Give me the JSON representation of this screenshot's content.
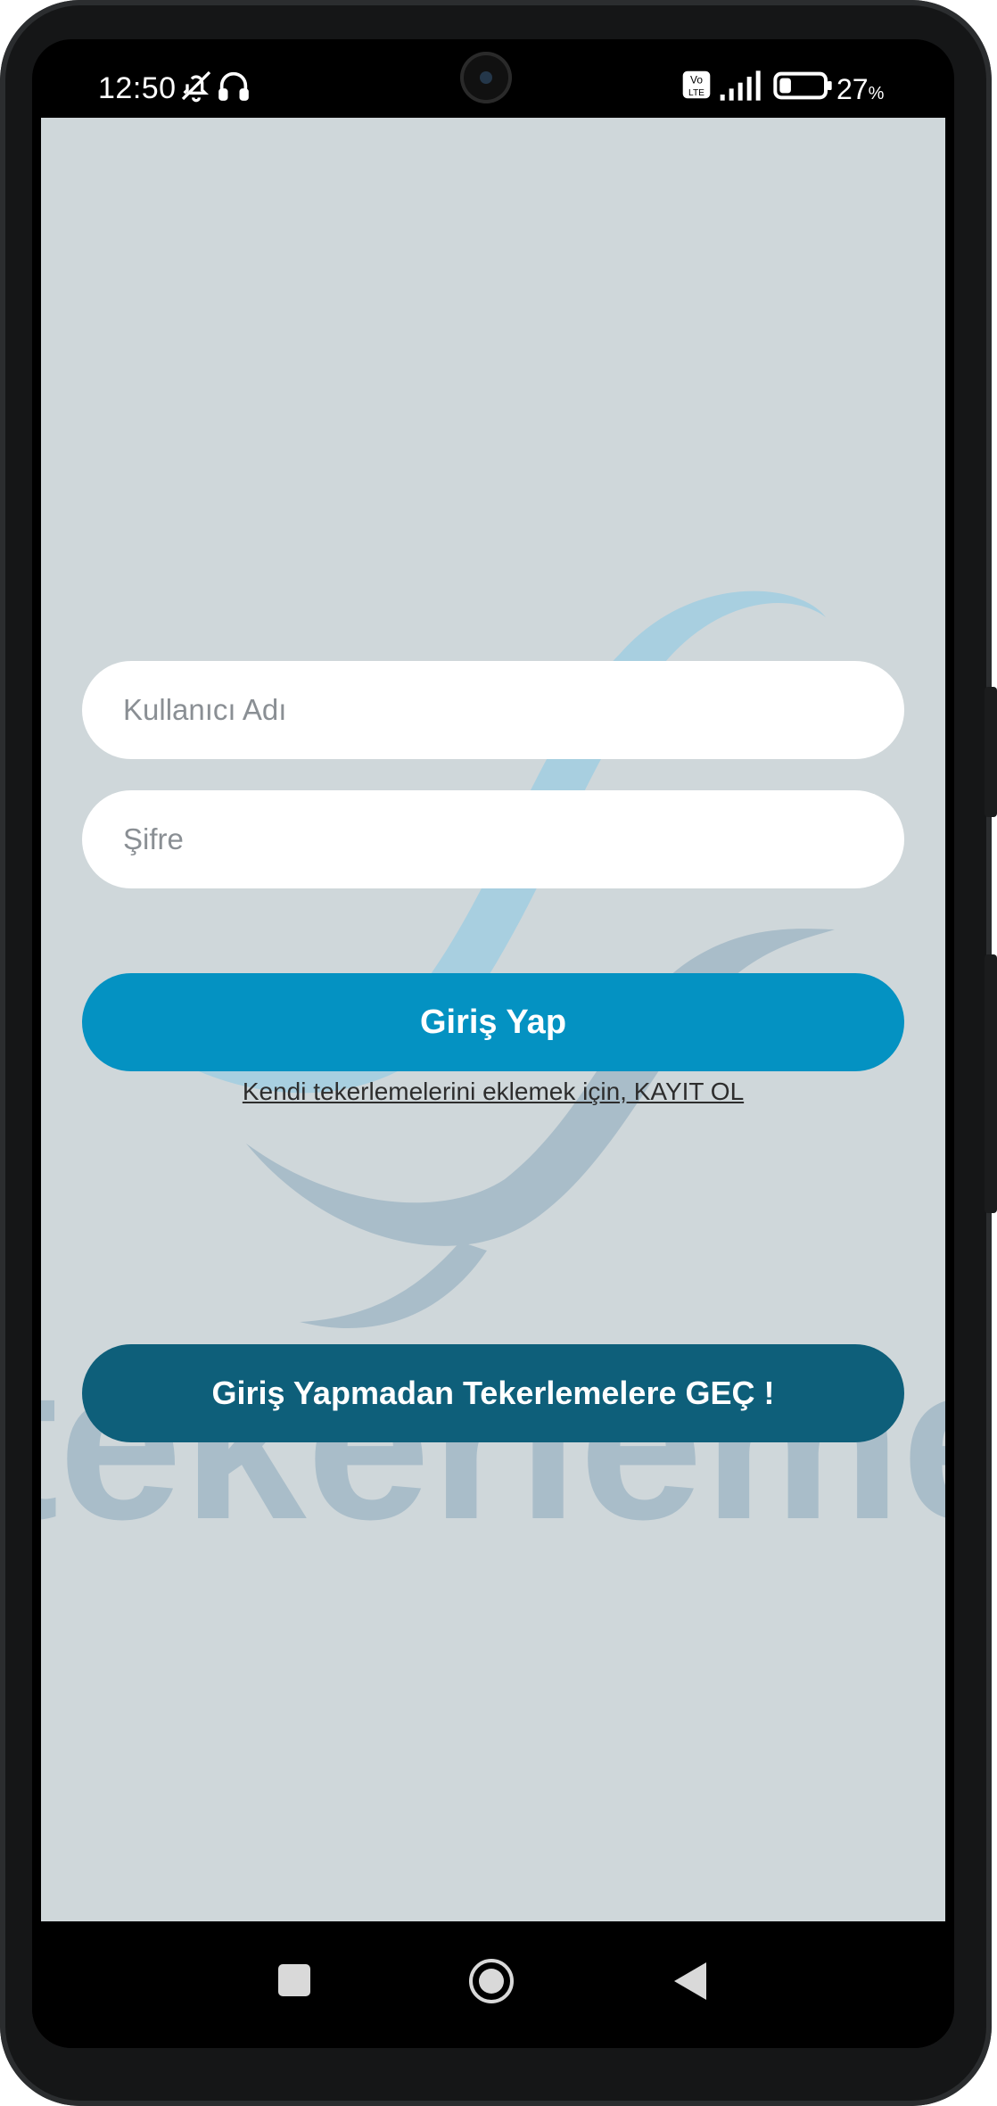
{
  "status_bar": {
    "time": "12:50",
    "battery_percent": "27",
    "battery_unit": "%",
    "battery_level": 0.27,
    "icons": [
      "bell-off-icon",
      "headphones-icon",
      "volte-icon",
      "signal-icon",
      "battery-icon"
    ]
  },
  "login": {
    "username_placeholder": "Kullanıcı Adı",
    "username_value": "",
    "password_placeholder": "Şifre",
    "password_value": "",
    "login_button": "Giriş Yap",
    "register_link": "Kendi tekerlemelerini eklemek için, KAYIT OL",
    "skip_button": "Giriş Yapmadan Tekerlemelere GEÇ !"
  },
  "background_logo": {
    "text": "tekerleme",
    "colors": {
      "light_swoosh": "#a8cfe0",
      "dark_swoosh": "#a9bdc9",
      "text": "#a9bdc9"
    }
  },
  "nav_bar": {
    "icons": [
      "recent-apps-icon",
      "home-icon",
      "back-icon"
    ]
  },
  "colors": {
    "app_background": "#cfd7da",
    "login_button": "#0492c2",
    "skip_button": "#0e5f7a",
    "input_background": "#ffffff"
  }
}
